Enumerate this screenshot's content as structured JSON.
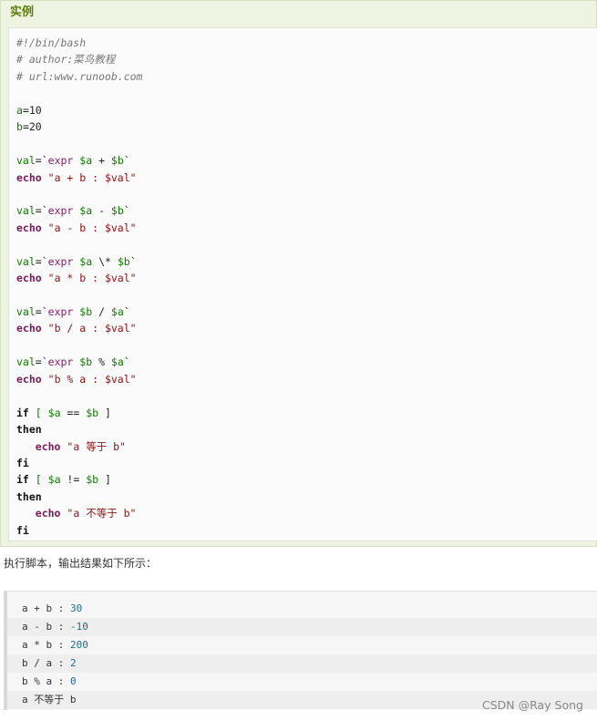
{
  "example": {
    "title": "实例",
    "code_lines": [
      [
        {
          "t": "#!/bin/bash",
          "k": "comment"
        }
      ],
      [
        {
          "t": "# author:菜鸟教程",
          "k": "comment"
        }
      ],
      [
        {
          "t": "# url:www.runoob.com",
          "k": "comment"
        }
      ],
      [],
      [
        {
          "t": "a",
          "k": "var"
        },
        {
          "t": "=10",
          "k": "plain"
        }
      ],
      [
        {
          "t": "b",
          "k": "var"
        },
        {
          "t": "=20",
          "k": "plain"
        }
      ],
      [],
      [
        {
          "t": "val",
          "k": "var"
        },
        {
          "t": "=`",
          "k": "plain"
        },
        {
          "t": "expr",
          "k": "sub"
        },
        {
          "t": " ",
          "k": "plain"
        },
        {
          "t": "$a",
          "k": "var"
        },
        {
          "t": " + ",
          "k": "plain"
        },
        {
          "t": "$b",
          "k": "var"
        },
        {
          "t": "`",
          "k": "plain"
        }
      ],
      [
        {
          "t": "echo",
          "k": "keyword"
        },
        {
          "t": " ",
          "k": "plain"
        },
        {
          "t": "\"a + b : $val\"",
          "k": "str"
        }
      ],
      [],
      [
        {
          "t": "val",
          "k": "var"
        },
        {
          "t": "=`",
          "k": "plain"
        },
        {
          "t": "expr",
          "k": "sub"
        },
        {
          "t": " ",
          "k": "plain"
        },
        {
          "t": "$a",
          "k": "var"
        },
        {
          "t": " - ",
          "k": "plain"
        },
        {
          "t": "$b",
          "k": "var"
        },
        {
          "t": "`",
          "k": "plain"
        }
      ],
      [
        {
          "t": "echo",
          "k": "keyword"
        },
        {
          "t": " ",
          "k": "plain"
        },
        {
          "t": "\"a - b : $val\"",
          "k": "str"
        }
      ],
      [],
      [
        {
          "t": "val",
          "k": "var"
        },
        {
          "t": "=`",
          "k": "plain"
        },
        {
          "t": "expr",
          "k": "sub"
        },
        {
          "t": " ",
          "k": "plain"
        },
        {
          "t": "$a",
          "k": "var"
        },
        {
          "t": " \\* ",
          "k": "plain"
        },
        {
          "t": "$b",
          "k": "var"
        },
        {
          "t": "`",
          "k": "plain"
        }
      ],
      [
        {
          "t": "echo",
          "k": "keyword"
        },
        {
          "t": " ",
          "k": "plain"
        },
        {
          "t": "\"a * b : $val\"",
          "k": "str"
        }
      ],
      [],
      [
        {
          "t": "val",
          "k": "var"
        },
        {
          "t": "=`",
          "k": "plain"
        },
        {
          "t": "expr",
          "k": "sub"
        },
        {
          "t": " ",
          "k": "plain"
        },
        {
          "t": "$b",
          "k": "var"
        },
        {
          "t": " / ",
          "k": "plain"
        },
        {
          "t": "$a",
          "k": "var"
        },
        {
          "t": "`",
          "k": "plain"
        }
      ],
      [
        {
          "t": "echo",
          "k": "keyword"
        },
        {
          "t": " ",
          "k": "plain"
        },
        {
          "t": "\"b / a : $val\"",
          "k": "str"
        }
      ],
      [],
      [
        {
          "t": "val",
          "k": "var"
        },
        {
          "t": "=`",
          "k": "plain"
        },
        {
          "t": "expr",
          "k": "sub"
        },
        {
          "t": " ",
          "k": "plain"
        },
        {
          "t": "$b",
          "k": "var"
        },
        {
          "t": " % ",
          "k": "plain"
        },
        {
          "t": "$a",
          "k": "var"
        },
        {
          "t": "`",
          "k": "plain"
        }
      ],
      [
        {
          "t": "echo",
          "k": "keyword"
        },
        {
          "t": " ",
          "k": "plain"
        },
        {
          "t": "\"b % a : $val\"",
          "k": "str"
        }
      ],
      [],
      [
        {
          "t": "if",
          "k": "ctrl"
        },
        {
          "t": " [ ",
          "k": "var"
        },
        {
          "t": "$a",
          "k": "var"
        },
        {
          "t": " == ",
          "k": "plain"
        },
        {
          "t": "$b",
          "k": "var"
        },
        {
          "t": " ]",
          "k": "plain"
        }
      ],
      [
        {
          "t": "then",
          "k": "ctrl"
        }
      ],
      [
        {
          "t": "   ",
          "k": "plain"
        },
        {
          "t": "echo",
          "k": "keyword"
        },
        {
          "t": " ",
          "k": "plain"
        },
        {
          "t": "\"a 等于 b\"",
          "k": "str"
        }
      ],
      [
        {
          "t": "fi",
          "k": "ctrl"
        }
      ],
      [
        {
          "t": "if",
          "k": "ctrl"
        },
        {
          "t": " [ ",
          "k": "var"
        },
        {
          "t": "$a",
          "k": "var"
        },
        {
          "t": " != ",
          "k": "plain"
        },
        {
          "t": "$b",
          "k": "var"
        },
        {
          "t": " ]",
          "k": "plain"
        }
      ],
      [
        {
          "t": "then",
          "k": "ctrl"
        }
      ],
      [
        {
          "t": "   ",
          "k": "plain"
        },
        {
          "t": "echo",
          "k": "keyword"
        },
        {
          "t": " ",
          "k": "plain"
        },
        {
          "t": "\"a 不等于 b\"",
          "k": "str"
        }
      ],
      [
        {
          "t": "fi",
          "k": "ctrl"
        }
      ]
    ]
  },
  "description": "执行脚本，输出结果如下所示：",
  "output": {
    "lines": [
      [
        {
          "t": "a + b : ",
          "k": "plain"
        },
        {
          "t": "30",
          "k": "num"
        }
      ],
      [
        {
          "t": "a - b : ",
          "k": "plain"
        },
        {
          "t": "-10",
          "k": "num"
        }
      ],
      [
        {
          "t": "a * b : ",
          "k": "plain"
        },
        {
          "t": "200",
          "k": "num"
        }
      ],
      [
        {
          "t": "b / a : ",
          "k": "plain"
        },
        {
          "t": "2",
          "k": "num"
        }
      ],
      [
        {
          "t": "b % a : ",
          "k": "plain"
        },
        {
          "t": "0",
          "k": "num"
        }
      ],
      [
        {
          "t": "a 不等于 b",
          "k": "plain"
        }
      ]
    ]
  },
  "watermark": "CSDN @Ray Song",
  "colors": {
    "example_background": "#eef3e2",
    "example_title": "#617f10",
    "code_variable": "#0f7a00",
    "code_keyword": "#7a1a5a",
    "code_string": "#8a1212",
    "code_comment": "#777777",
    "output_number": "#1e6e8c"
  }
}
